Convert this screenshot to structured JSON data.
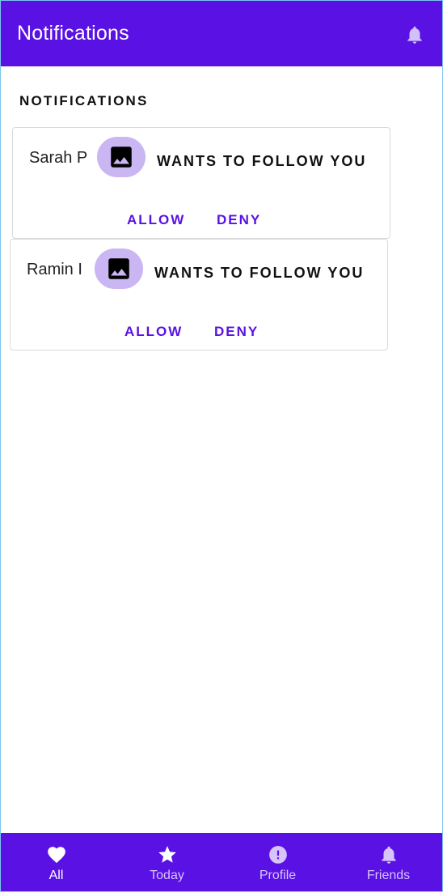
{
  "appbar": {
    "title": "Notifications",
    "icon": "bell-icon"
  },
  "section": {
    "label": "NOTIFICATIONS"
  },
  "notifications": [
    {
      "sender": "Sarah P",
      "avatar_icon": "image-icon",
      "message": "WANTS TO FOLLOW YOU",
      "allow_label": "ALLOW",
      "deny_label": "DENY"
    },
    {
      "sender": "Ramin I",
      "avatar_icon": "image-icon",
      "message": "WANTS TO FOLLOW YOU",
      "allow_label": "ALLOW",
      "deny_label": "DENY"
    }
  ],
  "bottom_nav": {
    "items": [
      {
        "label": "All",
        "icon": "heart-icon",
        "active": true
      },
      {
        "label": "Today",
        "icon": "star-icon",
        "active": false
      },
      {
        "label": "Profile",
        "icon": "alert-icon",
        "active": false
      },
      {
        "label": "Friends",
        "icon": "bell-icon",
        "active": false
      }
    ]
  },
  "colors": {
    "primary": "#5a11e4",
    "avatar_bg": "#c9b6f3",
    "nav_inactive": "#d7c4fb",
    "card_border": "#dadada"
  }
}
